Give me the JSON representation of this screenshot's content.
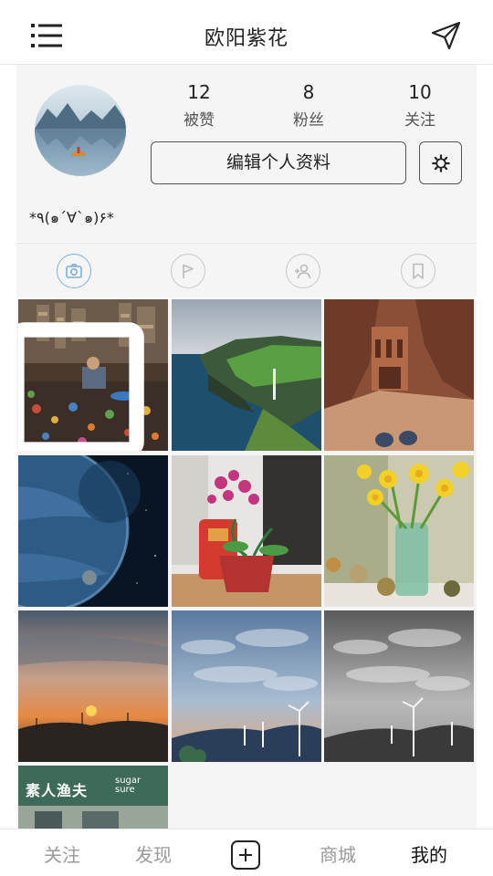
{
  "header": {
    "title": "欧阳紫花",
    "menu_icon": "menu-icon",
    "send_icon": "send-icon"
  },
  "profile": {
    "stats": [
      {
        "value": "12",
        "label": "被赞"
      },
      {
        "value": "8",
        "label": "粉丝"
      },
      {
        "value": "10",
        "label": "关注"
      }
    ],
    "edit_label": "编辑个人资料",
    "settings_icon": "gear-icon",
    "bio": "*٩(๑´∀`๑)۶*"
  },
  "tabs": [
    {
      "icon": "camera-icon",
      "active": true
    },
    {
      "icon": "flag-icon",
      "active": false
    },
    {
      "icon": "add-person-icon",
      "active": false
    },
    {
      "icon": "bookmark-icon",
      "active": false
    }
  ],
  "photos": [
    {
      "subject": "workshop"
    },
    {
      "subject": "cliff-waterfall"
    },
    {
      "subject": "canyon-ruins"
    },
    {
      "subject": "planet-space"
    },
    {
      "subject": "orchid-pot"
    },
    {
      "subject": "daffodils-vase"
    },
    {
      "subject": "sunset-hills"
    },
    {
      "subject": "wind-turbines-color"
    },
    {
      "subject": "wind-turbines-bw"
    },
    {
      "subject": "shop-sign",
      "sign_text": "素人渔夫",
      "sign_sub1": "sugar",
      "sign_sub2": "sure"
    }
  ],
  "bottom_nav": {
    "items": [
      "关注",
      "发现",
      "商城",
      "我的"
    ],
    "add_icon": "plus-icon",
    "active": "我的"
  },
  "colors": {
    "accent": "#7fb0d8",
    "panel_bg": "#f5f5f5",
    "border": "#555555"
  }
}
